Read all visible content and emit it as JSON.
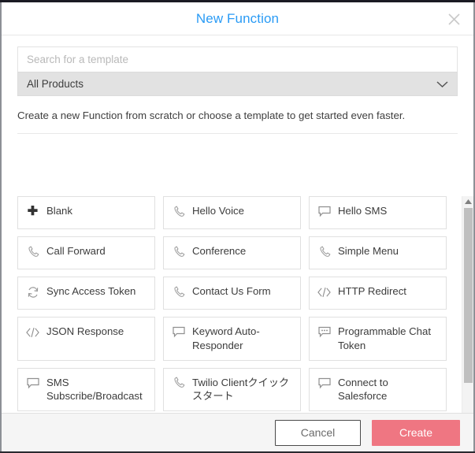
{
  "window": {
    "accent_blue": "#2a9bf5",
    "create_button_color": "#ef7682"
  },
  "modal": {
    "title": "New Function",
    "close_icon": "close-icon",
    "search": {
      "placeholder": "Search for a template",
      "value": ""
    },
    "filter": {
      "selected": "All Products",
      "chevron_icon": "chevron-down-icon"
    },
    "description": "Create a new Function from scratch or choose a template to get started even faster.",
    "templates": [
      {
        "label": "Blank",
        "icon": "plus-icon"
      },
      {
        "label": "Hello Voice",
        "icon": "phone-icon"
      },
      {
        "label": "Hello SMS",
        "icon": "sms-bubble-icon"
      },
      {
        "label": "Call Forward",
        "icon": "phone-icon"
      },
      {
        "label": "Conference",
        "icon": "phone-icon"
      },
      {
        "label": "Simple Menu",
        "icon": "phone-icon"
      },
      {
        "label": "Sync Access Token",
        "icon": "sync-icon"
      },
      {
        "label": "Contact Us Form",
        "icon": "phone-icon"
      },
      {
        "label": "HTTP Redirect",
        "icon": "code-brackets-icon"
      },
      {
        "label": "JSON Response",
        "icon": "code-brackets-icon"
      },
      {
        "label": "Keyword Auto-Responder",
        "icon": "sms-bubble-icon"
      },
      {
        "label": "Programmable Chat Token",
        "icon": "chat-dots-icon"
      },
      {
        "label": "SMS Subscribe/Broadcast",
        "icon": "sms-bubble-icon"
      },
      {
        "label": "Twilio Clientクイックスタート",
        "icon": "phone-icon"
      },
      {
        "label": "Connect to Salesforce",
        "icon": "sms-bubble-icon"
      }
    ],
    "scrollbar": {
      "up_icon": "scroll-up-arrow-icon",
      "down_icon": "scroll-down-arrow-icon"
    },
    "footer": {
      "cancel_label": "Cancel",
      "create_label": "Create"
    }
  }
}
